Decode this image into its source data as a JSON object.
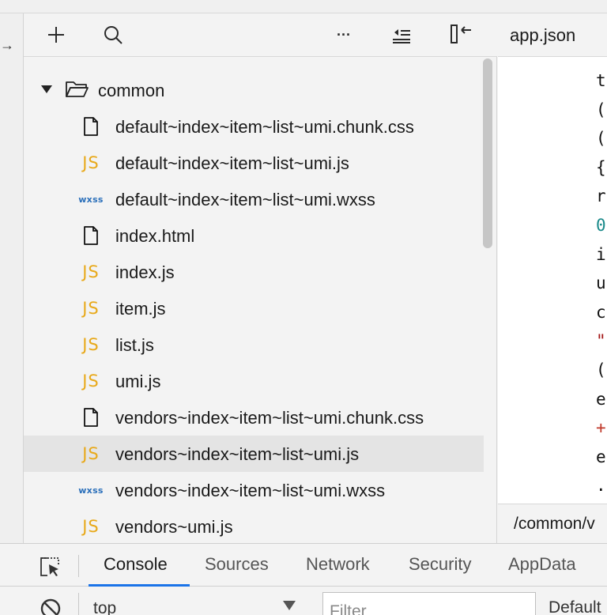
{
  "toolbar": {
    "icons": [
      "plus-icon",
      "search-icon",
      "more-icon",
      "collapse-all-icon",
      "hide-sidebar-icon"
    ],
    "more_glyph": "···"
  },
  "tree": {
    "folder": {
      "label": "common",
      "icon": "folder-open-icon",
      "expanded": true
    },
    "files": [
      {
        "label": "default~index~item~list~umi.chunk.css",
        "type": "file"
      },
      {
        "label": "default~index~item~list~umi.js",
        "type": "js"
      },
      {
        "label": "default~index~item~list~umi.wxss",
        "type": "wxss"
      },
      {
        "label": "index.html",
        "type": "file"
      },
      {
        "label": "index.js",
        "type": "js"
      },
      {
        "label": "item.js",
        "type": "js"
      },
      {
        "label": "list.js",
        "type": "js"
      },
      {
        "label": "umi.js",
        "type": "js"
      },
      {
        "label": "vendors~index~item~list~umi.chunk.css",
        "type": "file"
      },
      {
        "label": "vendors~index~item~list~umi.js",
        "type": "js",
        "selected": true
      },
      {
        "label": "vendors~index~item~list~umi.wxss",
        "type": "wxss"
      },
      {
        "label": "vendors~umi.js",
        "type": "js"
      }
    ],
    "js_glyph": "JS",
    "wxss_glyph": "wxss"
  },
  "editor": {
    "tab_label": "app.json",
    "code_lines": [
      {
        "text": "t",
        "color": "#111111"
      },
      {
        "text": "(",
        "color": "#111111"
      },
      {
        "text": "(",
        "color": "#111111"
      },
      {
        "text": "{",
        "color": "#111111"
      },
      {
        "text": "r",
        "color": "#111111"
      },
      {
        "text": "0",
        "color": "#1a8a8a"
      },
      {
        "text": "i",
        "color": "#111111"
      },
      {
        "text": "u",
        "color": "#111111"
      },
      {
        "text": "c",
        "color": "#111111"
      },
      {
        "text": "\"",
        "color": "#a31515"
      },
      {
        "text": "(",
        "color": "#111111"
      },
      {
        "text": "e",
        "color": "#111111"
      },
      {
        "text": "+",
        "color": "#c0392b"
      },
      {
        "text": "e",
        "color": "#111111"
      },
      {
        "text": ".",
        "color": "#111111"
      }
    ],
    "path": "/common/v"
  },
  "devtools": {
    "tabs": [
      {
        "label": "Console",
        "active": true
      },
      {
        "label": "Sources"
      },
      {
        "label": "Network"
      },
      {
        "label": "Security"
      },
      {
        "label": "AppData"
      }
    ],
    "context_value": "top",
    "filter_placeholder": "Filter",
    "levels_label": "Default"
  },
  "colors": {
    "accent": "#1a73e8",
    "js_icon": "#e8a91a",
    "wxss_icon": "#2a6fba",
    "selected_row": "#e4e4e4"
  }
}
